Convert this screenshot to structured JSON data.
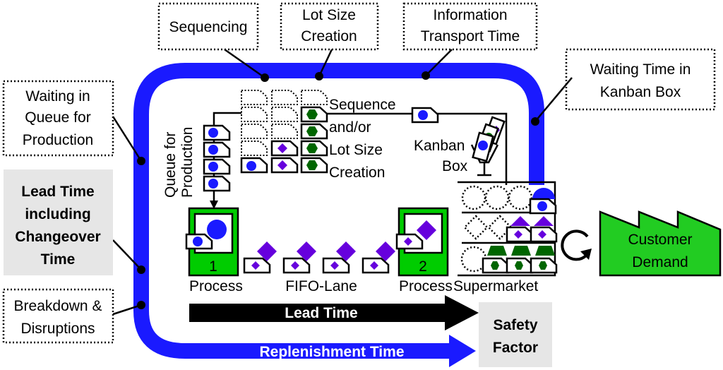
{
  "colors": {
    "loop": "#1a1aff",
    "process": "#00cc00",
    "customer": "#22cc22",
    "circle": "#1a1aff",
    "diamond": "#6600dd",
    "hexagon": "#006600",
    "callout_gray": "#e6e6e6"
  },
  "callouts": {
    "sequencing": "Sequencing",
    "lot_size": [
      "Lot Size",
      "Creation"
    ],
    "info_transport": [
      "Information",
      "Transport Time"
    ],
    "waiting_kanban": [
      "Waiting Time in",
      "Kanban Box"
    ],
    "waiting_queue": [
      "Waiting in",
      "Queue for",
      "Production"
    ],
    "lead_time_changeover": [
      "Lead Time",
      "including",
      "Changeover",
      "Time"
    ],
    "breakdown": [
      "Breakdown &",
      "Disruptions"
    ]
  },
  "labels": {
    "queue": [
      "Queue for",
      "Production"
    ],
    "sequence": [
      "Sequence",
      "and/or",
      "Lot Size",
      "Creation"
    ],
    "kanban_box": [
      "Kanban",
      "Box"
    ],
    "process1_number": "1",
    "process2_number": "2",
    "process1": "Process",
    "fifo": "FIFO-Lane",
    "process2": "Process",
    "supermarket": "Supermarket",
    "customer": [
      "Customer",
      "Demand"
    ],
    "lead_time": "Lead Time",
    "replenishment": "Replenishment Time",
    "safety_factor": [
      "Safety",
      "Factor"
    ]
  }
}
